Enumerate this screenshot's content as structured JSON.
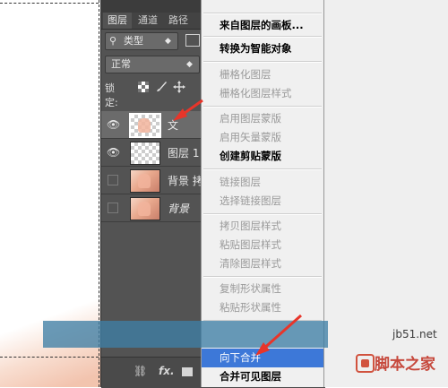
{
  "layers_panel": {
    "tabs": [
      "图层",
      "通道",
      "路径"
    ],
    "filter_value": "类型",
    "blend_mode": "正常",
    "lock_label": "锁定:",
    "layers": [
      {
        "name": "文",
        "visible": true,
        "selected": true,
        "thumb": "transparent"
      },
      {
        "name": "图层 1",
        "visible": true,
        "selected": false,
        "thumb": "transparent"
      },
      {
        "name": "背景 拷",
        "visible": false,
        "selected": false,
        "thumb": "photo"
      },
      {
        "name": "背景",
        "visible": false,
        "selected": false,
        "thumb": "photo"
      }
    ],
    "bottom_fx": "fx."
  },
  "context_menu": {
    "items": [
      {
        "label": "来自图层的画板...",
        "state": "bold"
      },
      {
        "label": "转换为智能对象",
        "state": "bold"
      },
      {
        "label": "栅格化图层",
        "state": "disabled"
      },
      {
        "label": "栅格化图层样式",
        "state": "disabled"
      },
      {
        "label": "启用图层蒙版",
        "state": "disabled"
      },
      {
        "label": "启用矢量蒙版",
        "state": "disabled"
      },
      {
        "label": "创建剪贴蒙版",
        "state": "bold"
      },
      {
        "label": "链接图层",
        "state": "disabled"
      },
      {
        "label": "选择链接图层",
        "state": "disabled"
      },
      {
        "label": "拷贝图层样式",
        "state": "disabled"
      },
      {
        "label": "粘贴图层样式",
        "state": "disabled"
      },
      {
        "label": "清除图层样式",
        "state": "disabled"
      },
      {
        "label": "复制形状属性",
        "state": "disabled"
      },
      {
        "label": "粘贴形状属性",
        "state": "disabled"
      },
      {
        "label": "向下合并",
        "state": "highlight"
      },
      {
        "label": "合并可见图层",
        "state": "bold"
      }
    ]
  },
  "watermark": {
    "site": "jb51.net",
    "name": "脚本之家"
  },
  "colors": {
    "panel_bg": "#535353",
    "menu_highlight": "#3d78d8",
    "arrow_red": "#e8352a"
  }
}
